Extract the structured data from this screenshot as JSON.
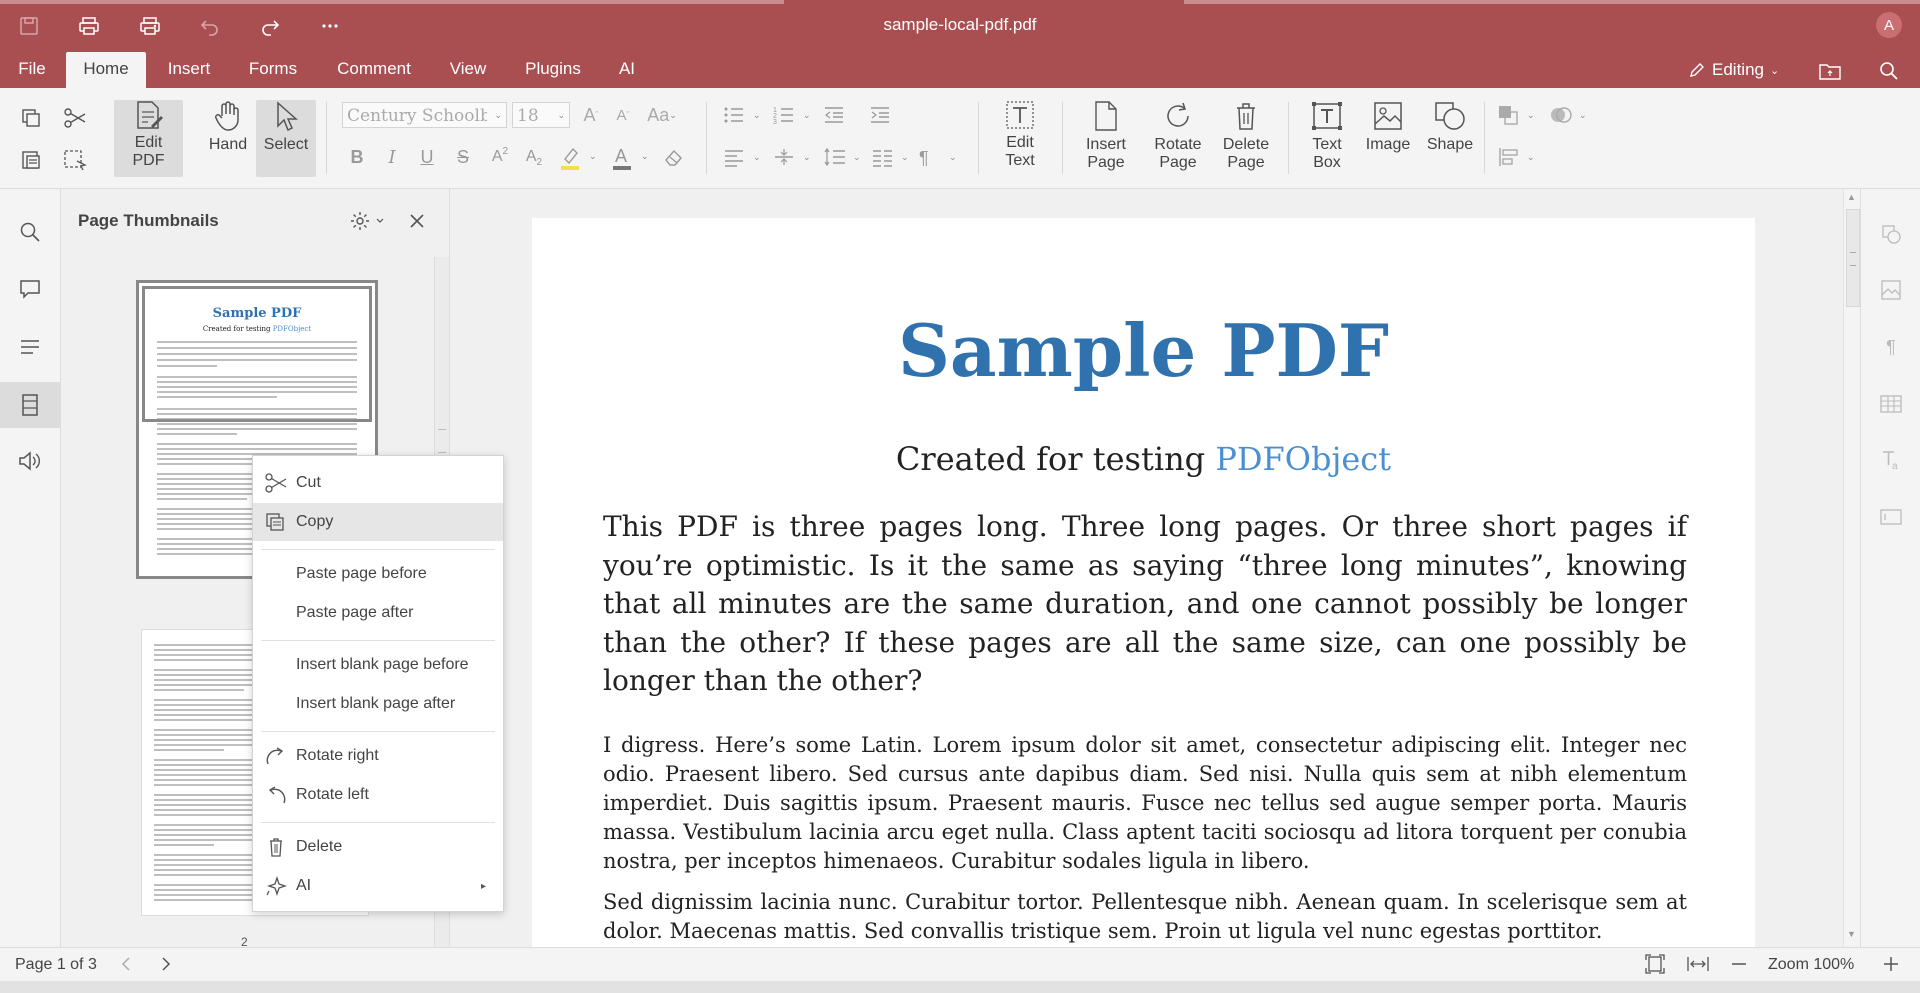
{
  "window": {
    "title": "sample-local-pdf.pdf",
    "user_initial": "A"
  },
  "menu": {
    "tabs": [
      "File",
      "Home",
      "Insert",
      "Forms",
      "Comment",
      "View",
      "Plugins",
      "AI"
    ],
    "active": "Home",
    "mode": "Editing"
  },
  "toolbar": {
    "edit_pdf": "Edit PDF",
    "hand": "Hand",
    "select": "Select",
    "font_name": "Century Schoolbook",
    "font_size": "18",
    "edit_text": "Edit Text",
    "insert_page": "Insert Page",
    "rotate_page": "Rotate Page",
    "delete_page": "Delete Page",
    "text_box": "Text Box",
    "image": "Image",
    "shape": "Shape"
  },
  "panel": {
    "title": "Page Thumbnails",
    "page2_number": "2"
  },
  "context_menu": {
    "cut": "Cut",
    "copy": "Copy",
    "paste_before": "Paste page before",
    "paste_after": "Paste page after",
    "insert_blank_before": "Insert blank page before",
    "insert_blank_after": "Insert blank page after",
    "rotate_right": "Rotate right",
    "rotate_left": "Rotate left",
    "delete": "Delete",
    "ai": "AI"
  },
  "document": {
    "title": "Sample PDF",
    "subtitle_prefix": "Created for testing ",
    "subtitle_link": "PDFObject",
    "para1": "This PDF is three pages long. Three long pages. Or three short pages if you’re optimistic. Is it the same as saying “three long minutes”, knowing that all minutes are the same duration, and one cannot possibly be longer than the other? If these pages are all the same size, can one possibly be longer than the other?",
    "para2": "I digress. Here’s some Latin. Lorem ipsum dolor sit amet, consectetur adipiscing elit. Integer nec odio. Praesent libero. Sed cursus ante dapibus diam. Sed nisi. Nulla quis sem at nibh elementum imperdiet. Duis sagittis ipsum. Praesent mauris. Fusce nec tellus sed augue semper porta. Mauris massa. Vestibulum lacinia arcu eget nulla. Class aptent taciti sociosqu ad litora torquent per conubia nostra, per inceptos himenaeos. Curabitur sodales ligula in libero.",
    "para3": "Sed dignissim lacinia nunc. Curabitur tortor. Pellentesque nibh. Aenean quam. In scelerisque sem at dolor. Maecenas mattis. Sed convallis tristique sem. Proin ut ligula vel nunc egestas porttitor."
  },
  "status": {
    "page_label": "Page 1 of 3",
    "zoom_label": "Zoom 100%"
  },
  "colors": {
    "accent": "#a94f52",
    "title_blue": "#2f72ad",
    "link_blue": "#4a8fd0"
  }
}
